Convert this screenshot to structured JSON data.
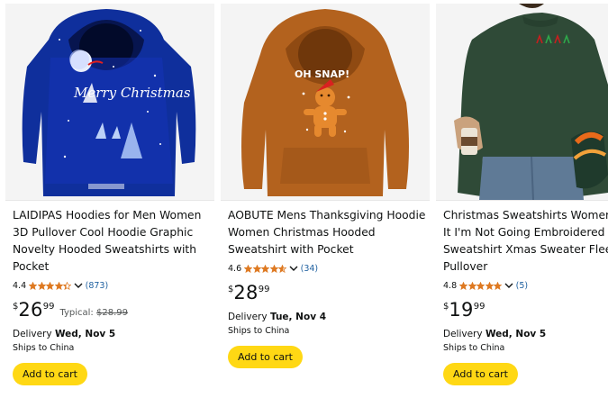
{
  "products": [
    {
      "title_lines": [
        "LAIDIPAS Hoodies for Men Women",
        "3D Pullover Cool Hoodie Graphic",
        "Novelty Hooded Sweatshirts with",
        "Pocket"
      ],
      "rating": "4.4",
      "stars": 4.4,
      "review_count": "(873)",
      "price_symbol": "$",
      "price_whole": "26",
      "price_fraction": "99",
      "typical_label": "Typical:",
      "typical_price": "$28.99",
      "delivery_label": "Delivery",
      "delivery_date": "Wed, Nov 5",
      "ships_to": "Ships to China",
      "cart_label": "Add to cart",
      "image_text": "Merry Christmas",
      "star_color": "#de7921"
    },
    {
      "title_lines": [
        "AOBUTE Mens Thanksgiving Hoodie",
        "Women Christmas Hooded",
        "Sweatshirt with Pocket"
      ],
      "rating": "4.6",
      "stars": 4.6,
      "review_count": "(34)",
      "price_symbol": "$",
      "price_whole": "28",
      "price_fraction": "99",
      "delivery_label": "Delivery",
      "delivery_date": "Tue, Nov 4",
      "ships_to": "Ships to China",
      "cart_label": "Add to cart",
      "image_text": "OH SNAP!",
      "star_color": "#de7921"
    },
    {
      "title_lines": [
        "Christmas Sweatshirts Women T",
        "It I'm Not Going Embroidered",
        "Sweatshirt Xmas Sweater Fleece",
        "Pullover"
      ],
      "rating": "4.8",
      "stars": 4.8,
      "review_count": "(5)",
      "price_symbol": "$",
      "price_whole": "19",
      "price_fraction": "99",
      "delivery_label": "Delivery",
      "delivery_date": "Wed, Nov 5",
      "ships_to": "Ships to China",
      "cart_label": "Add to cart",
      "star_color": "#de7921"
    }
  ]
}
